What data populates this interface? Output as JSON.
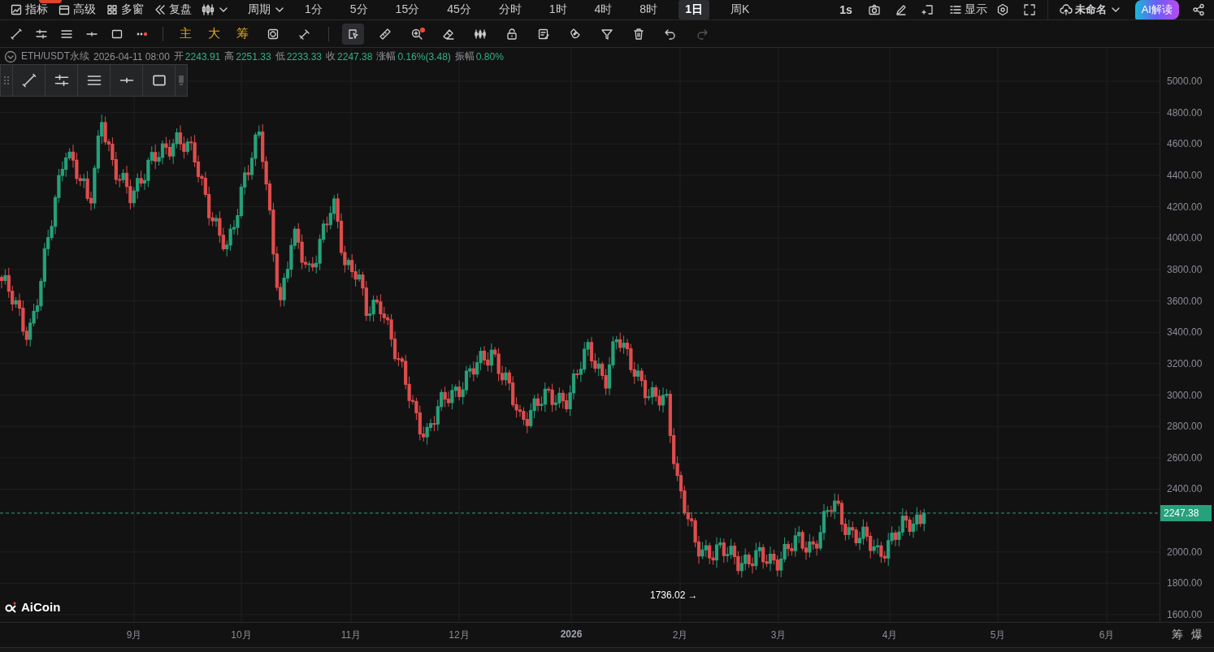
{
  "top_bar": {
    "menus": [
      {
        "label": "指标",
        "kind": "indicator",
        "badge": true
      },
      {
        "label": "高级",
        "kind": "window",
        "badge": false
      },
      {
        "label": "多窗",
        "kind": "grid",
        "badge": false
      },
      {
        "label": "复盘",
        "kind": "rewind",
        "badge": false
      }
    ],
    "period_menu": "周期",
    "periods": [
      {
        "label": "1分",
        "selected": false
      },
      {
        "label": "5分",
        "selected": false
      },
      {
        "label": "15分",
        "selected": false
      },
      {
        "label": "45分",
        "selected": false
      },
      {
        "label": "分时",
        "selected": false
      },
      {
        "label": "1时",
        "selected": false
      },
      {
        "label": "4时",
        "selected": false
      },
      {
        "label": "8时",
        "selected": false
      },
      {
        "label": "1日",
        "selected": true
      },
      {
        "label": "周K",
        "selected": false
      }
    ],
    "refresh": "1s",
    "display": "显示",
    "layout_name": "未命名",
    "ai_button": "AI解读"
  },
  "tool_bar": {
    "left_tools": [
      {
        "kind": "line"
      },
      {
        "kind": "parallel"
      },
      {
        "kind": "lines"
      },
      {
        "kind": "hray"
      },
      {
        "kind": "rect"
      },
      {
        "kind": "more"
      }
    ],
    "text_tools": [
      "主",
      "大",
      "筹"
    ],
    "tools": [
      {
        "kind": "cycle",
        "selected": false,
        "disabled": false
      },
      {
        "kind": "brush",
        "selected": false,
        "disabled": false
      },
      {
        "kind": "select",
        "selected": true,
        "disabled": false
      },
      {
        "kind": "ruler",
        "selected": false,
        "disabled": false
      },
      {
        "kind": "zoom",
        "selected": false,
        "disabled": false
      },
      {
        "kind": "eraser",
        "selected": false,
        "disabled": false
      },
      {
        "kind": "bars",
        "selected": false,
        "disabled": false
      },
      {
        "kind": "lock",
        "selected": false,
        "disabled": false
      },
      {
        "kind": "note",
        "selected": false,
        "disabled": false
      },
      {
        "kind": "magnet",
        "selected": false,
        "disabled": false
      },
      {
        "kind": "filter",
        "selected": false,
        "disabled": false
      },
      {
        "kind": "trash",
        "selected": false,
        "disabled": false
      },
      {
        "kind": "undo",
        "selected": false,
        "disabled": false
      },
      {
        "kind": "redo",
        "selected": false,
        "disabled": true
      }
    ]
  },
  "info": {
    "symbol": "ETH/USDT永续",
    "time": "2026-04-11 08:00",
    "fields": [
      {
        "label": "开",
        "value": "2243.91"
      },
      {
        "label": "高",
        "value": "2251.33"
      },
      {
        "label": "低",
        "value": "2233.33"
      },
      {
        "label": "收",
        "value": "2247.38"
      },
      {
        "label": "涨幅",
        "value": "0.16%(3.48)"
      },
      {
        "label": "振幅",
        "value": "0.80%"
      }
    ]
  },
  "floating_tools": [
    {
      "kind": "line"
    },
    {
      "kind": "parallel"
    },
    {
      "kind": "lines"
    },
    {
      "kind": "hray"
    },
    {
      "kind": "rect"
    }
  ],
  "chart": {
    "price_ticks": [
      "5000.00",
      "4800.00",
      "4600.00",
      "4400.00",
      "4200.00",
      "4000.00",
      "3800.00",
      "3600.00",
      "3400.00",
      "3200.00",
      "3000.00",
      "2800.00",
      "2600.00",
      "2400.00",
      "2000.00",
      "1800.00",
      "1600.00"
    ],
    "time_labels": [
      {
        "label": "9月",
        "kind": "month"
      },
      {
        "label": "10月",
        "kind": "month"
      },
      {
        "label": "11月",
        "kind": "month"
      },
      {
        "label": "12月",
        "kind": "month"
      },
      {
        "label": "2026",
        "kind": "year"
      },
      {
        "label": "2月",
        "kind": "month"
      },
      {
        "label": "3月",
        "kind": "month"
      },
      {
        "label": "4月",
        "kind": "month"
      },
      {
        "label": "5月",
        "kind": "month"
      },
      {
        "label": "6月",
        "kind": "month"
      }
    ],
    "last_price": "2247.38",
    "low_label": "1736.02",
    "low_arrow": "→",
    "logo": "AiCoin"
  },
  "axis_buttons": [
    "筹",
    "爆"
  ]
}
